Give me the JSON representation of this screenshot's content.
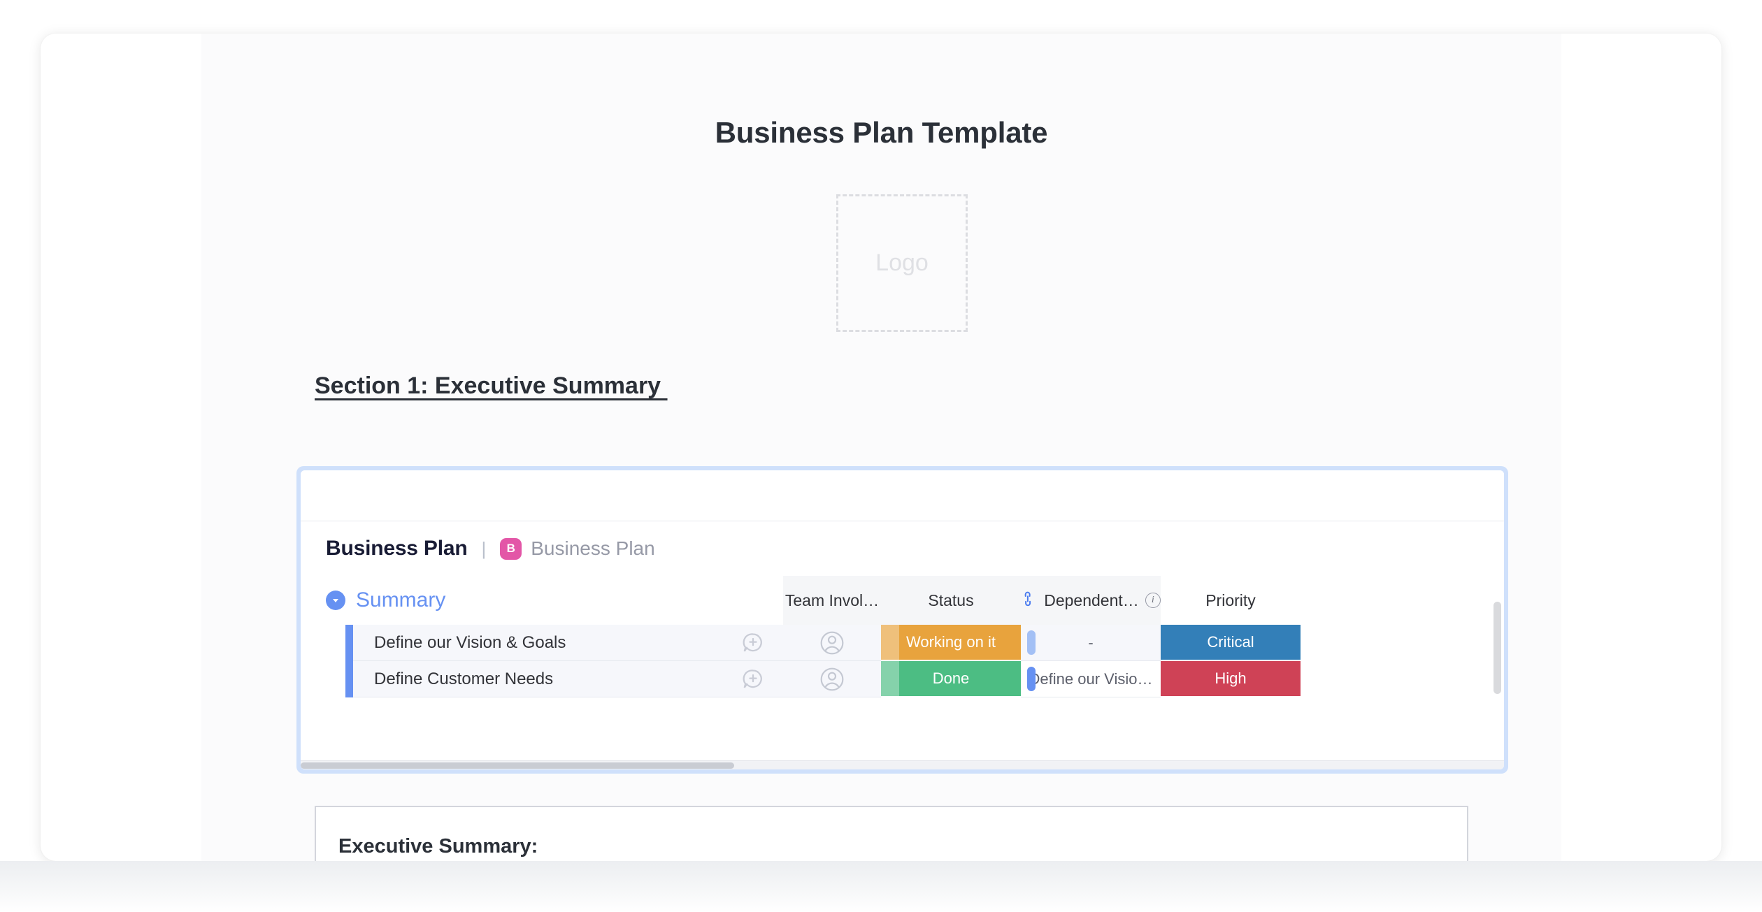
{
  "document": {
    "title": "Business Plan Template",
    "logo_placeholder": "Logo",
    "section_heading": "Section 1: Executive Summary "
  },
  "embed": {
    "board_name": "Business Plan",
    "separator": "|",
    "board_badge_letter": "B",
    "board_subtitle": "Business Plan",
    "group": {
      "label": "Summary",
      "collapse_icon": "chevron-down-icon",
      "color": "#6691f2"
    },
    "columns": [
      {
        "label": "Team Invol…",
        "name": "team-involved"
      },
      {
        "label": "Status",
        "name": "status"
      },
      {
        "label": "Dependent…",
        "name": "dependent-on",
        "link_icon": "link-icon",
        "info_icon": "info-icon"
      },
      {
        "label": "Priority",
        "name": "priority"
      }
    ],
    "rows": [
      {
        "name": "Define our Vision & Goals",
        "person": "",
        "status": {
          "label": "Working on it",
          "color": "#e8a33d"
        },
        "dependent_on": "-",
        "priority": {
          "label": "Critical",
          "color": "#337fb8"
        }
      },
      {
        "name": "Define Customer Needs",
        "person": "",
        "status": {
          "label": "Done",
          "color": "#4cbd83"
        },
        "dependent_on": "Define our Visio…",
        "priority": {
          "label": "High",
          "color": "#cf4256"
        }
      }
    ],
    "icons": {
      "add_comment": "add-comment-icon",
      "person_placeholder": "person-avatar-icon"
    }
  },
  "exec_summary": {
    "title": "Executive Summary:"
  },
  "colors": {
    "embed_border": "#cfe0fb",
    "group_blue": "#6691f2",
    "badge_pink": "#e356a7",
    "status_working": "#e8a33d",
    "status_done": "#4cbd83",
    "priority_critical": "#337fb8",
    "priority_high": "#cf4256"
  }
}
